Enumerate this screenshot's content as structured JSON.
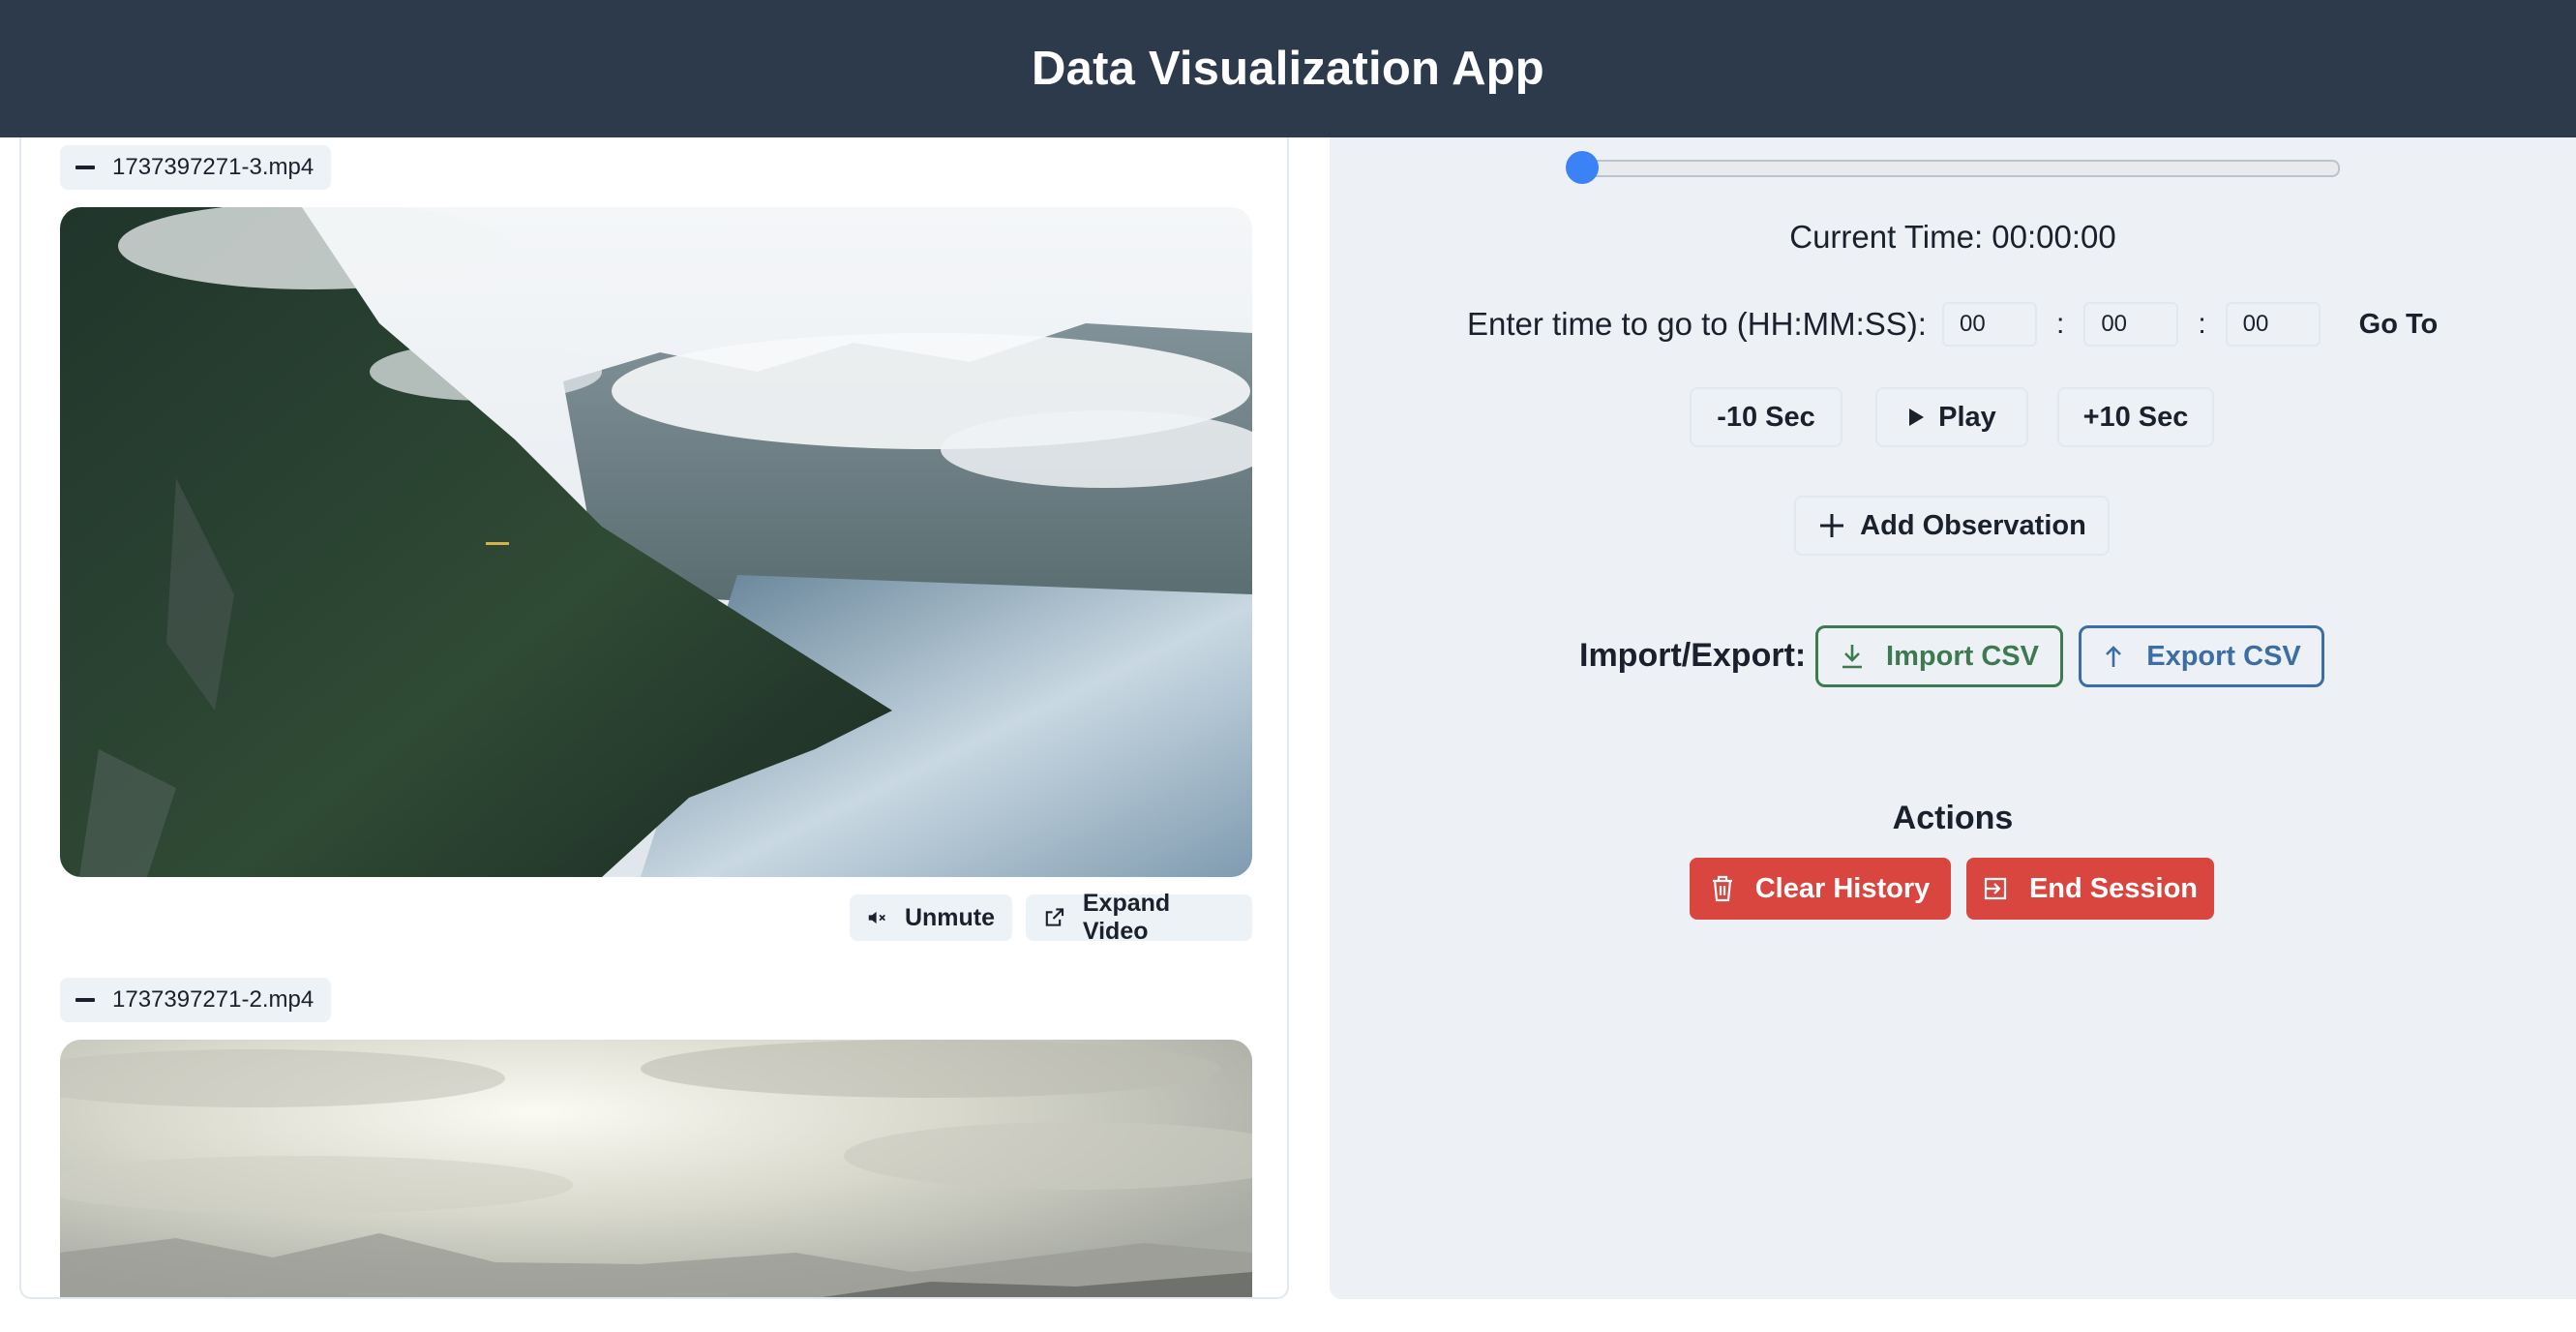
{
  "app": {
    "title": "Data Visualization App"
  },
  "videos": [
    {
      "filename": "1737397271-3.mp4"
    },
    {
      "filename": "1737397271-2.mp4"
    }
  ],
  "video_controls": {
    "unmute_label": "Unmute",
    "expand_label": "Expand Video"
  },
  "player": {
    "current_time_label": "Current Time: 00:00:00",
    "goto_label": "Enter time to go to (HH:MM:SS):",
    "hours": "00",
    "minutes": "00",
    "seconds": "00",
    "separator": ":",
    "goto_button": "Go To",
    "slider_position": 0,
    "back_label": "-10 Sec",
    "play_label": "Play",
    "forward_label": "+10 Sec",
    "add_observation_label": "Add Observation"
  },
  "import_export": {
    "label": "Import/Export:",
    "import_label": "Import CSV",
    "export_label": "Export CSV",
    "import_color": "#3d7a4f",
    "export_color": "#3a6ea5"
  },
  "actions": {
    "heading": "Actions",
    "clear_label": "Clear History",
    "end_label": "End Session",
    "danger_color": "#d9453f"
  },
  "icons": [
    "minus-icon",
    "mute-icon",
    "external-link-icon",
    "play-icon",
    "plus-icon",
    "download-icon",
    "upload-icon",
    "trash-icon",
    "exit-icon"
  ]
}
